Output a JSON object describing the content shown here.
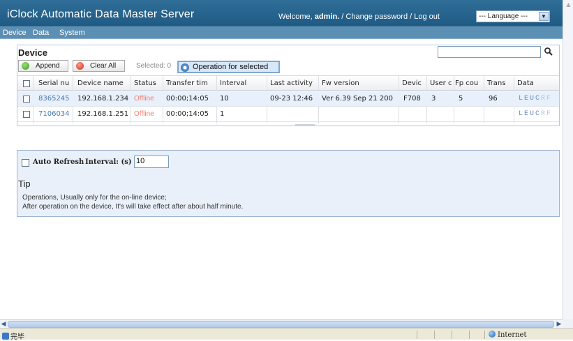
{
  "header": {
    "title": "iClock Automatic Data Master Server",
    "welcome_prefix": "Welcome,",
    "user": "admin.",
    "change_password": "/ Change password",
    "logout": "/ Log out",
    "language_select": "--- Language ---"
  },
  "menu": [
    "Device",
    "Data",
    "System"
  ],
  "device_panel": {
    "title": "Device",
    "append_label": "Append",
    "clear_all_label": "Clear All",
    "selected_label": "Selected: 0",
    "operation_label": "Operation for selected",
    "columns": [
      "Serial nu",
      "Device name",
      "Status",
      "Transfer tim",
      "Interval",
      "Last activity",
      "Fw version",
      "Devic",
      "User c",
      "Fp cou",
      "Trans",
      "Data"
    ],
    "rows": [
      {
        "serial": "8365245",
        "name": "192.168.1.234",
        "status": "Offline",
        "transfer": "00:00;14:05",
        "interval": "10",
        "last_activity": "09-23 12:46",
        "fw": "Ver 6.39 Sep 21 200",
        "device": "F708",
        "users": "3",
        "fp": "5",
        "trans": "96",
        "data": "LEUCRF"
      },
      {
        "serial": "7106034",
        "name": "192.168.1.251",
        "status": "Offline",
        "transfer": "00:00;14:05",
        "interval": "1",
        "last_activity": "",
        "fw": "",
        "device": "",
        "users": "",
        "fp": "",
        "trans": "",
        "data": "LEUCRF"
      }
    ]
  },
  "refresh": {
    "auto_refresh_label": "Auto Refresh",
    "interval_label": "Interval: (s)",
    "interval_value": "10"
  },
  "tip": {
    "title": "Tip",
    "line1": "Operations, Usually only for the on-line device;",
    "line2": "After operation on the device, It's will take effect after about half minute."
  },
  "statusbar": {
    "left": "完毕",
    "zone": "Internet"
  },
  "colors": {
    "header_bg": "#2a6690",
    "menubar_bg": "#5c8fb4",
    "offline": "#f08070",
    "link": "#4a78b0",
    "panel_bg": "#e9f0fa"
  }
}
